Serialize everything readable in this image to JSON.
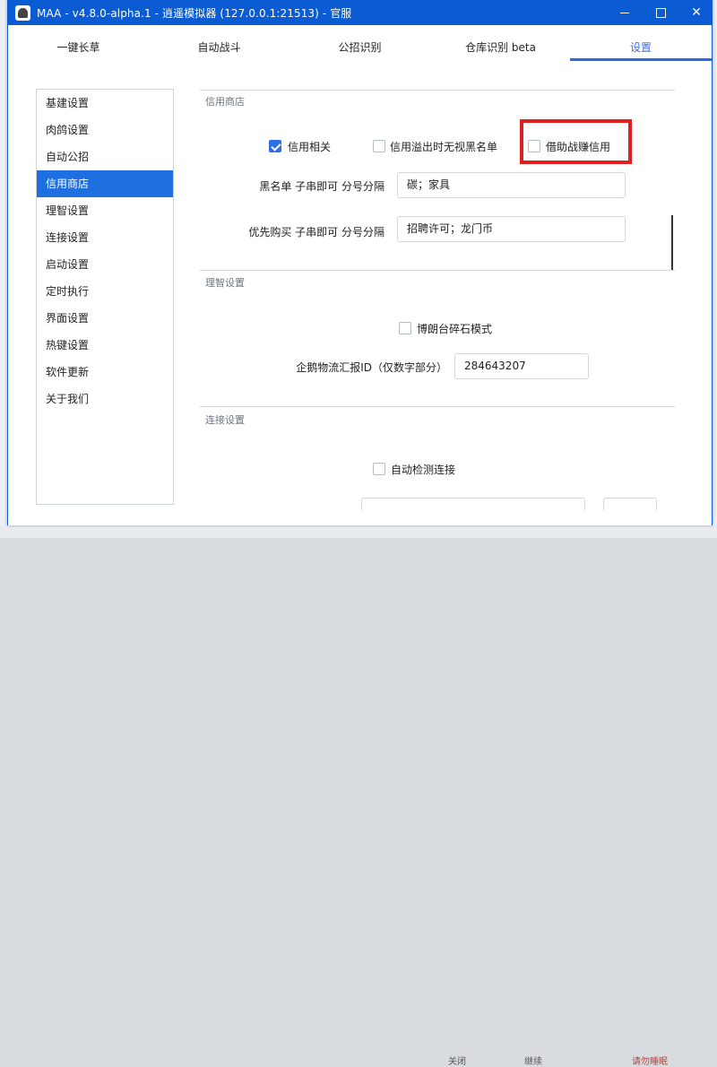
{
  "window": {
    "title": "MAA - v4.8.0-alpha.1 - 逍遥模拟器 (127.0.0.1:21513) - 官服"
  },
  "tabs": [
    {
      "label": "一键长草"
    },
    {
      "label": "自动战斗"
    },
    {
      "label": "公招识别"
    },
    {
      "label": "仓库识别 beta"
    },
    {
      "label": "设置",
      "active": true
    }
  ],
  "sidebar": {
    "items": [
      {
        "label": "基建设置"
      },
      {
        "label": "肉鸽设置"
      },
      {
        "label": "自动公招"
      },
      {
        "label": "信用商店",
        "active": true
      },
      {
        "label": "理智设置"
      },
      {
        "label": "连接设置"
      },
      {
        "label": "启动设置"
      },
      {
        "label": "定时执行"
      },
      {
        "label": "界面设置"
      },
      {
        "label": "热键设置"
      },
      {
        "label": "软件更新"
      },
      {
        "label": "关于我们"
      }
    ]
  },
  "credit_shop": {
    "title": "信用商店",
    "credit_related": {
      "label": "信用相关",
      "checked": true
    },
    "ignore_blacklist": {
      "label": "信用溢出时无视黑名单",
      "checked": false
    },
    "borrow_support": {
      "label": "借助战赚信用",
      "checked": false
    },
    "blacklist": {
      "label": "黑名单 子串即可 分号分隔",
      "value": "碳；家具"
    },
    "priority": {
      "label": "优先购买 子串即可 分号分隔",
      "value": "招聘许可；龙门币"
    }
  },
  "sanity": {
    "title": "理智设置",
    "dr_grandet": {
      "label": "博朗台碎石模式",
      "checked": false
    },
    "penguin_id": {
      "label": "企鹅物流汇报ID（仅数字部分）",
      "value": "284643207"
    }
  },
  "connection": {
    "title": "连接设置",
    "auto_detect": {
      "label": "自动检测连接",
      "checked": false
    }
  },
  "background": {
    "bottom_items": [
      {
        "label": "关闭"
      },
      {
        "label": "继续"
      },
      {
        "label": "请勿睡眠"
      }
    ]
  },
  "colors": {
    "accent": "#2f68e4",
    "titlebar": "#0b5bd3",
    "highlight": "#e02020"
  }
}
